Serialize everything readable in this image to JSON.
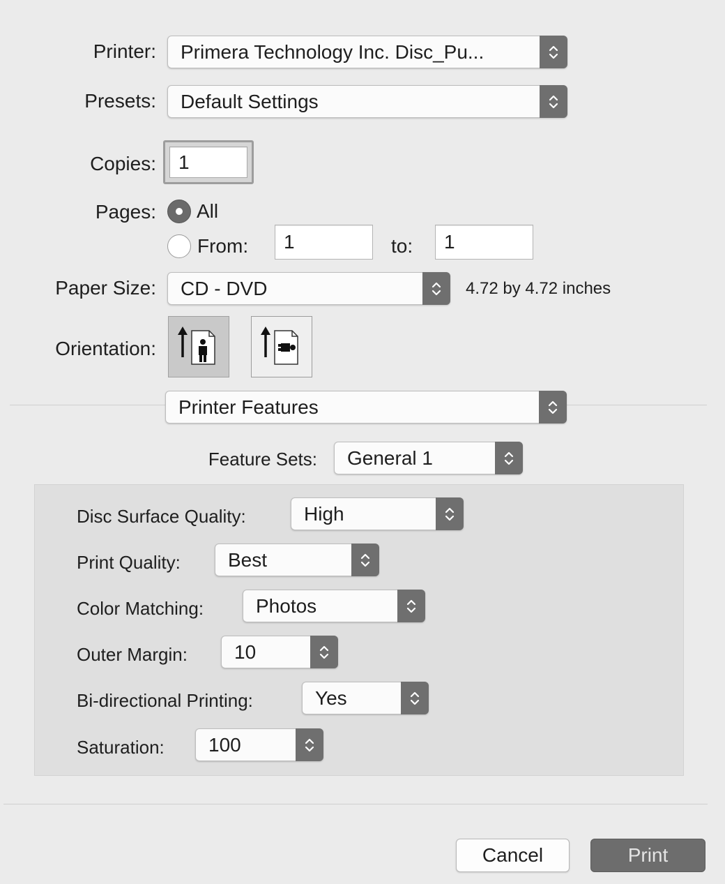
{
  "printer": {
    "label": "Printer:",
    "value": "Primera Technology Inc. Disc_Pu..."
  },
  "presets": {
    "label": "Presets:",
    "value": "Default Settings"
  },
  "copies": {
    "label": "Copies:",
    "value": "1"
  },
  "pages": {
    "label": "Pages:",
    "all_label": "All",
    "from_label": "From:",
    "from_value": "1",
    "to_label": "to:",
    "to_value": "1",
    "selected": "All"
  },
  "paper_size": {
    "label": "Paper Size:",
    "value": "CD - DVD",
    "dimensions": "4.72 by 4.72 inches"
  },
  "orientation": {
    "label": "Orientation:",
    "selected": "portrait"
  },
  "section_menu": {
    "value": "Printer Features"
  },
  "feature_sets": {
    "label": "Feature Sets:",
    "value": "General 1"
  },
  "features": {
    "disc_surface_quality": {
      "label": "Disc Surface Quality:",
      "value": "High"
    },
    "print_quality": {
      "label": "Print Quality:",
      "value": "Best"
    },
    "color_matching": {
      "label": "Color Matching:",
      "value": "Photos"
    },
    "outer_margin": {
      "label": "Outer Margin:",
      "value": "10"
    },
    "bidirectional": {
      "label": "Bi-directional Printing:",
      "value": "Yes"
    },
    "saturation": {
      "label": "Saturation:",
      "value": "100"
    }
  },
  "buttons": {
    "cancel": "Cancel",
    "print": "Print"
  },
  "icons": {
    "popup_arrows": "chevron-up-down-icon",
    "portrait": "portrait-orientation-icon",
    "landscape": "landscape-orientation-icon"
  }
}
